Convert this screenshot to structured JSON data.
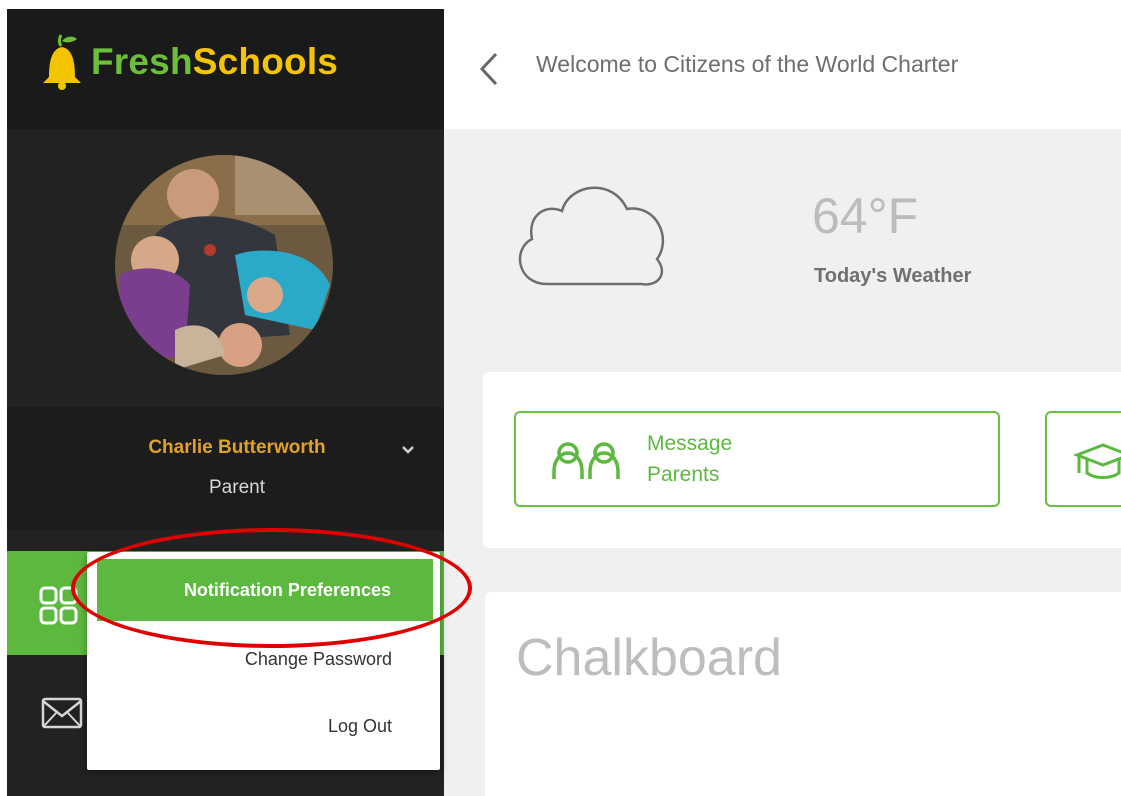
{
  "app": {
    "logo_fresh": "Fresh",
    "logo_schools": "Schools"
  },
  "colors": {
    "brand_green": "#5cb83f",
    "brand_yellow": "#f5c400",
    "user_name_color": "#e0a22a",
    "highlight_red": "#e00000"
  },
  "user": {
    "name": "Charlie Butterworth",
    "role": "Parent",
    "avatar": "profile-photo"
  },
  "user_menu": {
    "items": [
      {
        "label": "Notification Preferences",
        "active": true
      },
      {
        "label": "Change Password"
      },
      {
        "label": "Log Out"
      }
    ]
  },
  "sidebar": {
    "nav_icons": [
      "dashboard-icon",
      "mail-icon"
    ]
  },
  "header": {
    "title": "Welcome to Citizens of the World Charter",
    "back_icon": "chevron-left-icon"
  },
  "weather": {
    "temperature": "64°F",
    "label": "Today's Weather",
    "icon": "cloud-icon"
  },
  "actions": {
    "message_parents": "Message\nParents",
    "message_parents_icon": "people-icon",
    "graduation_icon": "graduation-cap-icon"
  },
  "chalkboard": {
    "title": "Chalkboard"
  }
}
